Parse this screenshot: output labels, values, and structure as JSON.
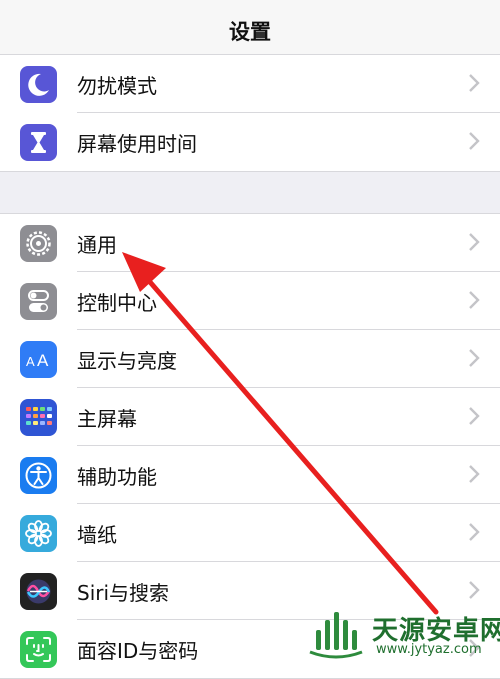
{
  "header": {
    "title": "设置"
  },
  "group1": [
    {
      "label": "勿扰模式",
      "icon": "moon-icon",
      "color": "#5856d6"
    },
    {
      "label": "屏幕使用时间",
      "icon": "hourglass-icon",
      "color": "#5856d6"
    }
  ],
  "group2": [
    {
      "label": "通用",
      "icon": "gear-icon",
      "color": "#8e8e93"
    },
    {
      "label": "控制中心",
      "icon": "toggles-icon",
      "color": "#8e8e93"
    },
    {
      "label": "显示与亮度",
      "icon": "text-size-icon",
      "color": "#2f7cf6"
    },
    {
      "label": "主屏幕",
      "icon": "home-grid-icon",
      "color": "#2f55d4"
    },
    {
      "label": "辅助功能",
      "icon": "accessibility-icon",
      "color": "#1a7cf0"
    },
    {
      "label": "墙纸",
      "icon": "flower-icon",
      "color": "#36aadc"
    },
    {
      "label": "Siri与搜索",
      "icon": "siri-icon",
      "color": "#222222"
    },
    {
      "label": "面容ID与密码",
      "icon": "face-id-icon",
      "color": "#34c759"
    }
  ],
  "annotation": {
    "arrow_color": "#e8201f"
  },
  "watermark": {
    "title": "天源安卓网",
    "url": "www.jytyaz.com"
  }
}
